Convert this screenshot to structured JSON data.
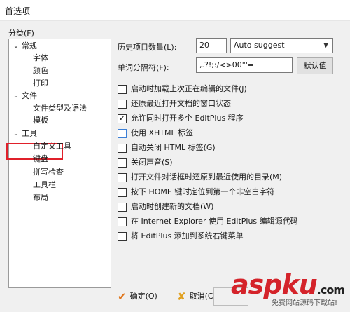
{
  "window": {
    "title": "首选项"
  },
  "category": {
    "label": "分类(F)",
    "tree": [
      {
        "label": "常规",
        "children": [
          "字体",
          "颜色",
          "打印"
        ]
      },
      {
        "label": "文件",
        "children": [
          "文件类型及语法",
          "模板"
        ]
      },
      {
        "label": "工具",
        "children": [
          "自定义工具",
          "键盘",
          "拼写检查",
          "工具栏",
          "布局"
        ]
      }
    ]
  },
  "settings": {
    "history_label": "历史项目数量(L):",
    "history_value": "20",
    "suggest_value": "Auto suggest",
    "delimiter_label": "单词分隔符(F):",
    "delimiter_value": ",.?!;:/<>00\"'=",
    "default_button": "默认值"
  },
  "options": [
    {
      "label": "启动时加载上次正在编辑的文件(J)",
      "checked": false
    },
    {
      "label": "还原最近打开文档的窗口状态",
      "checked": false
    },
    {
      "label": "允许同时打开多个 EditPlus 程序",
      "checked": true
    },
    {
      "label": "使用 XHTML 标签",
      "checked": false
    },
    {
      "label": "自动关闭 HTML 标签(G)",
      "checked": false
    },
    {
      "label": "关闭声音(S)",
      "checked": false
    },
    {
      "label": "打开文件对话框时还原到最近使用的目录(M)",
      "checked": false
    },
    {
      "label": "按下 HOME 键时定位到第一个非空白字符",
      "checked": false
    },
    {
      "label": "启动时创建新的文档(W)",
      "checked": false
    },
    {
      "label": "在 Internet Explorer 使用 EditPlus 编辑源代码",
      "checked": false
    },
    {
      "label": "将 EditPlus 添加到系统右键菜单",
      "checked": false
    }
  ],
  "footer": {
    "ok_label": "确定(O)",
    "cancel_label": "取消(C)"
  },
  "watermark": {
    "brand": "aspku",
    "suffix": ".com",
    "tagline": "免费网站源码下载站!"
  },
  "colors": {
    "highlight": "#e0202a",
    "checkbox_accent": "#3c7fd6",
    "ok_icon": "#e0761d"
  }
}
